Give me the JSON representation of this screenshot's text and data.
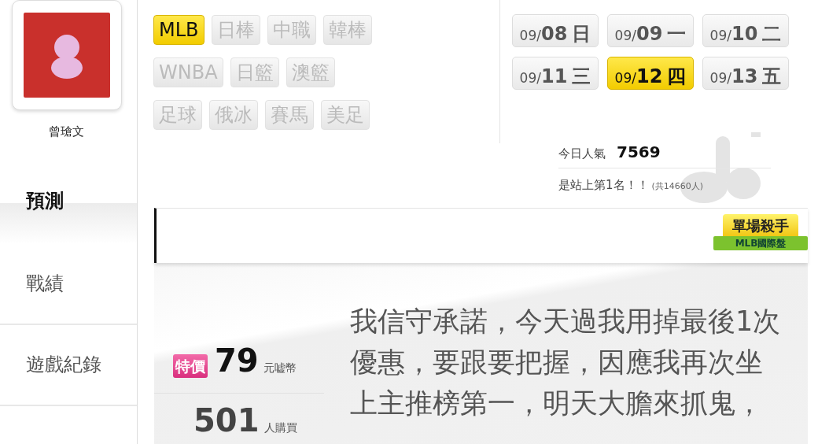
{
  "profile": {
    "name": "曾瑲文"
  },
  "sidebar": {
    "items": [
      {
        "label": "預測",
        "selected": true
      },
      {
        "label": "戰績",
        "selected": false
      },
      {
        "label": "遊戲紀錄",
        "selected": false
      }
    ]
  },
  "sports": [
    [
      {
        "label": "MLB",
        "selected": true
      },
      {
        "label": "日棒",
        "selected": false
      },
      {
        "label": "中職",
        "selected": false
      },
      {
        "label": "韓棒",
        "selected": false
      }
    ],
    [
      {
        "label": "WNBA",
        "selected": false
      },
      {
        "label": "日籃",
        "selected": false
      },
      {
        "label": "澳籃",
        "selected": false
      }
    ],
    [
      {
        "label": "足球",
        "selected": false
      },
      {
        "label": "俄冰",
        "selected": false
      },
      {
        "label": "賽馬",
        "selected": false
      },
      {
        "label": "美足",
        "selected": false
      }
    ]
  ],
  "dates": [
    {
      "month": "09/",
      "day": "08",
      "weekday": "日",
      "selected": false
    },
    {
      "month": "09/",
      "day": "09",
      "weekday": "一",
      "selected": false
    },
    {
      "month": "09/",
      "day": "10",
      "weekday": "二",
      "selected": false
    },
    {
      "month": "09/",
      "day": "11",
      "weekday": "三",
      "selected": false
    },
    {
      "month": "09/",
      "day": "12",
      "weekday": "四",
      "selected": true
    },
    {
      "month": "09/",
      "day": "13",
      "weekday": "五",
      "selected": false
    }
  ],
  "popularity": {
    "label": "今日人氣",
    "value": "7569",
    "rank_text": "是站上第1名！！",
    "total": "(共14660人)"
  },
  "title_badge": {
    "title": "單場殺手",
    "subtitle": "MLB國際盤"
  },
  "offer": {
    "tag": "特價",
    "price": "79",
    "unit": "元嘘幣",
    "buyers": "501",
    "buyers_unit": "人購買",
    "message": "我信守承諾，今天過我用掉最後1次優惠，要跟要把握，因應我再次坐上主推榜第一，明天大膽來抓鬼，"
  }
}
